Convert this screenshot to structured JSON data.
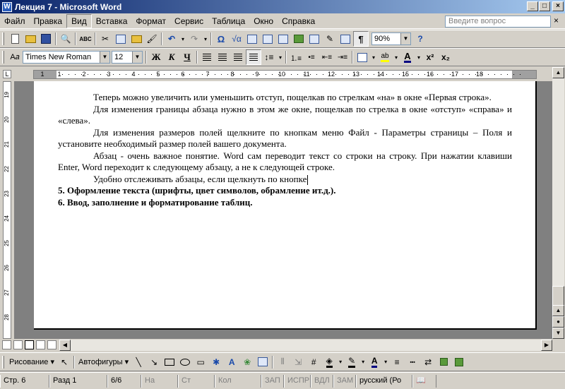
{
  "window": {
    "title": "Лекция 7 - Microsoft Word",
    "min": "_",
    "max": "□",
    "close": "×"
  },
  "menu": [
    "Файл",
    "Правка",
    "Вид",
    "Вставка",
    "Формат",
    "Сервис",
    "Таблица",
    "Окно",
    "Справка"
  ],
  "ask": {
    "placeholder": "Введите вопрос",
    "close": "×"
  },
  "toolbar": {
    "zoom": "90%",
    "paragraph_mark": "¶",
    "omega": "Ω"
  },
  "formatting": {
    "font": "Times New Roman",
    "size": "12",
    "bold": "Ж",
    "italic": "К",
    "underline": "Ч",
    "superscript": "x²",
    "subscript": "x₂",
    "font_color_letter": "A",
    "highlight": "ab"
  },
  "ruler": {
    "numbers": [
      "1",
      "1",
      "2",
      "3",
      "4",
      "5",
      "6",
      "7",
      "8",
      "9",
      "10",
      "11",
      "12",
      "13",
      "14",
      "15",
      "16",
      "17",
      "18"
    ]
  },
  "vruler": {
    "numbers": [
      "19",
      "20",
      "21",
      "22",
      "23",
      "24",
      "25",
      "26",
      "27",
      "28"
    ]
  },
  "document": {
    "paragraphs": [
      "Теперь можно увеличить или уменьшить отступ, пощелкав по стрелкам «на» в окне «Первая строка».",
      "Для изменения границы абзаца нужно в этом же окне, пощелкав по стрелка в окне «отступ» «справа» и «слева».",
      "Для изменения размеров полей щелкните по кнопкам меню Файл - Параметры страницы – Поля и установите необходимый размер полей вашего документа.",
      "Абзац  - очень важное понятие. Word сам переводит текст со строки на строку. При нажатии клавиши Enter, Word переходит к следующему абзацу, а не к следующей строке.",
      "Удобно отслеживать абзацы, если щелкнуть по кнопке"
    ],
    "headings": [
      "5.  Оформление текста (шрифты, цвет символов, обрамление  ит.д.).",
      "6.  Ввод, заполнение и форматирование таблиц."
    ]
  },
  "drawing": {
    "draw_label": "Рисование",
    "autoshapes_label": "Автофигуры"
  },
  "status": {
    "page": "Стр.  6",
    "section": "Разд  1",
    "pages": "6/6",
    "at": "На",
    "line": "Ст",
    "col": "Кол",
    "rec": "ЗАП",
    "trk": "ИСПР",
    "ext": "ВДЛ",
    "ovr": "ЗАМ",
    "lang": "русский (Ро"
  }
}
